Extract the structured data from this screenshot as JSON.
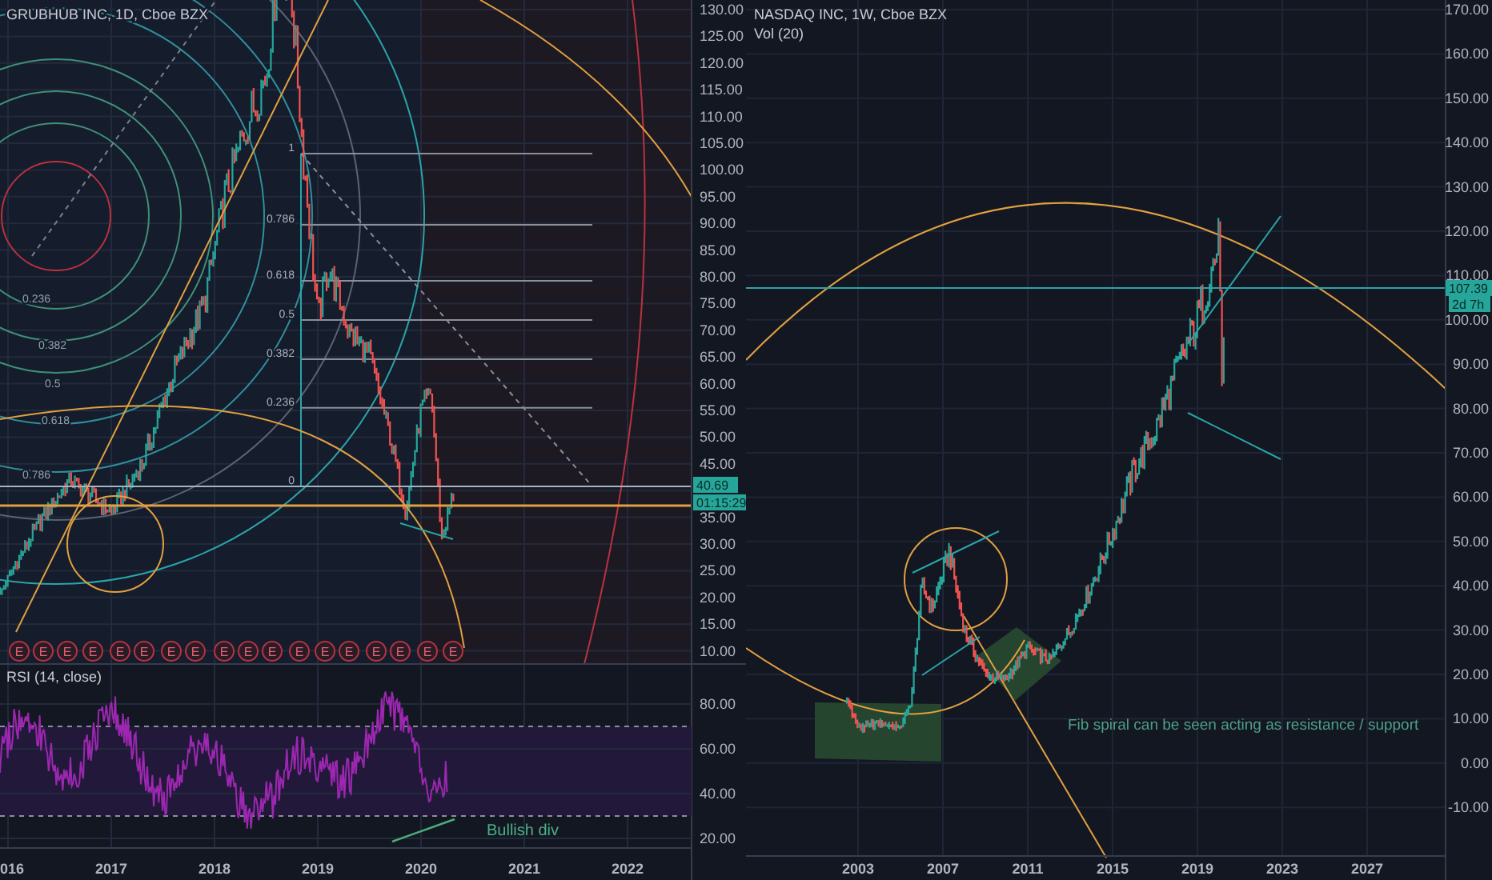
{
  "left_chart": {
    "title": "GRUBHUB INC, 1D, Cboe BZX",
    "price_axis": [
      "130.00",
      "125.00",
      "120.00",
      "115.00",
      "110.00",
      "105.00",
      "100.00",
      "95.00",
      "90.00",
      "85.00",
      "80.00",
      "75.00",
      "70.00",
      "65.00",
      "60.00",
      "55.00",
      "50.00",
      "45.00"
    ],
    "price_axis_below_tags": [
      "35.00",
      "30.00",
      "25.00",
      "20.00",
      "15.00",
      "10.00"
    ],
    "price_tags": [
      "40.69",
      "01:15:29"
    ],
    "fib_levels": [
      "1",
      "0.786",
      "0.618",
      "0.5",
      "0.382",
      "0.236",
      "0"
    ],
    "circle_levels": [
      "0.236",
      "0.382",
      "0.5",
      "0.618",
      "0.786"
    ],
    "earnings_markers": [
      "E",
      "E",
      "E",
      "E",
      "E",
      "E",
      "E",
      "E",
      "E",
      "E",
      "E",
      "E",
      "E",
      "E",
      "E",
      "E",
      "E",
      "E"
    ],
    "rsi": {
      "title": "RSI (14, close)",
      "axis": [
        "80.00",
        "60.00",
        "40.00",
        "20.00"
      ],
      "annotation": "Bullish div"
    },
    "time_axis": [
      "016",
      "2017",
      "2018",
      "2019",
      "2020",
      "2021",
      "2022"
    ]
  },
  "right_chart": {
    "title": "NASDAQ INC, 1W, Cboe BZX",
    "indicator": "Vol (20)",
    "price_axis": [
      "170.00",
      "160.00",
      "150.00",
      "140.00",
      "130.00",
      "120.00",
      "110.00",
      "100.00",
      "90.00",
      "80.00",
      "70.00",
      "60.00",
      "50.00",
      "40.00",
      "30.00",
      "20.00",
      "10.00",
      "0.00",
      "-10.00"
    ],
    "price_tags": [
      "107.39",
      "2d 7h"
    ],
    "annotation": "Fib spiral can be seen acting as resistance / support",
    "time_axis": [
      "2003",
      "2007",
      "2011",
      "2015",
      "2019",
      "2023",
      "2027"
    ]
  }
}
